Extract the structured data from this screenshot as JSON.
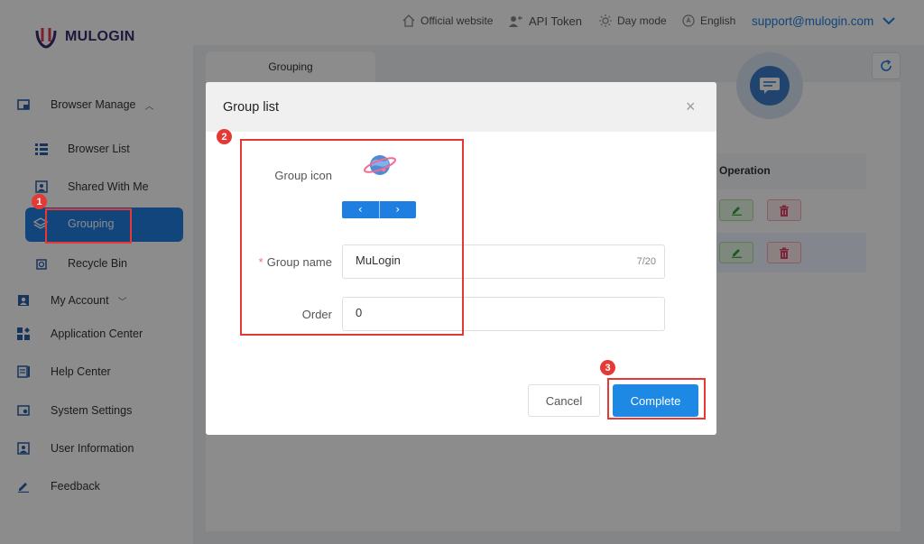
{
  "app": {
    "logo_text": "MULOGIN"
  },
  "topbar": {
    "official_website": "Official website",
    "api_token": "API Token",
    "day_mode": "Day mode",
    "language": "English",
    "account_email": "support@mulogin.com"
  },
  "sidebar": {
    "browser_manage": "Browser Manage",
    "browser_list": "Browser List",
    "shared_with_me": "Shared With Me",
    "grouping": "Grouping",
    "recycle_bin": "Recycle Bin",
    "my_account": "My Account",
    "application_center": "Application Center",
    "help_center": "Help Center",
    "system_settings": "System Settings",
    "user_information": "User Information",
    "feedback": "Feedback"
  },
  "page": {
    "tab_label": "Grouping",
    "operation_header": "Operation"
  },
  "modal": {
    "title": "Group list",
    "group_icon_label": "Group icon",
    "prev_icon": "‹",
    "next_icon": "›",
    "group_name_label": "Group name",
    "group_name_value": "MuLogin",
    "group_name_count": "7/20",
    "order_label": "Order",
    "order_value": "0",
    "cancel_label": "Cancel",
    "complete_label": "Complete"
  },
  "annotations": {
    "step1": "1",
    "step2": "2",
    "step3": "3"
  },
  "colors": {
    "accent": "#1f7fe0",
    "highlight": "#e53935"
  }
}
